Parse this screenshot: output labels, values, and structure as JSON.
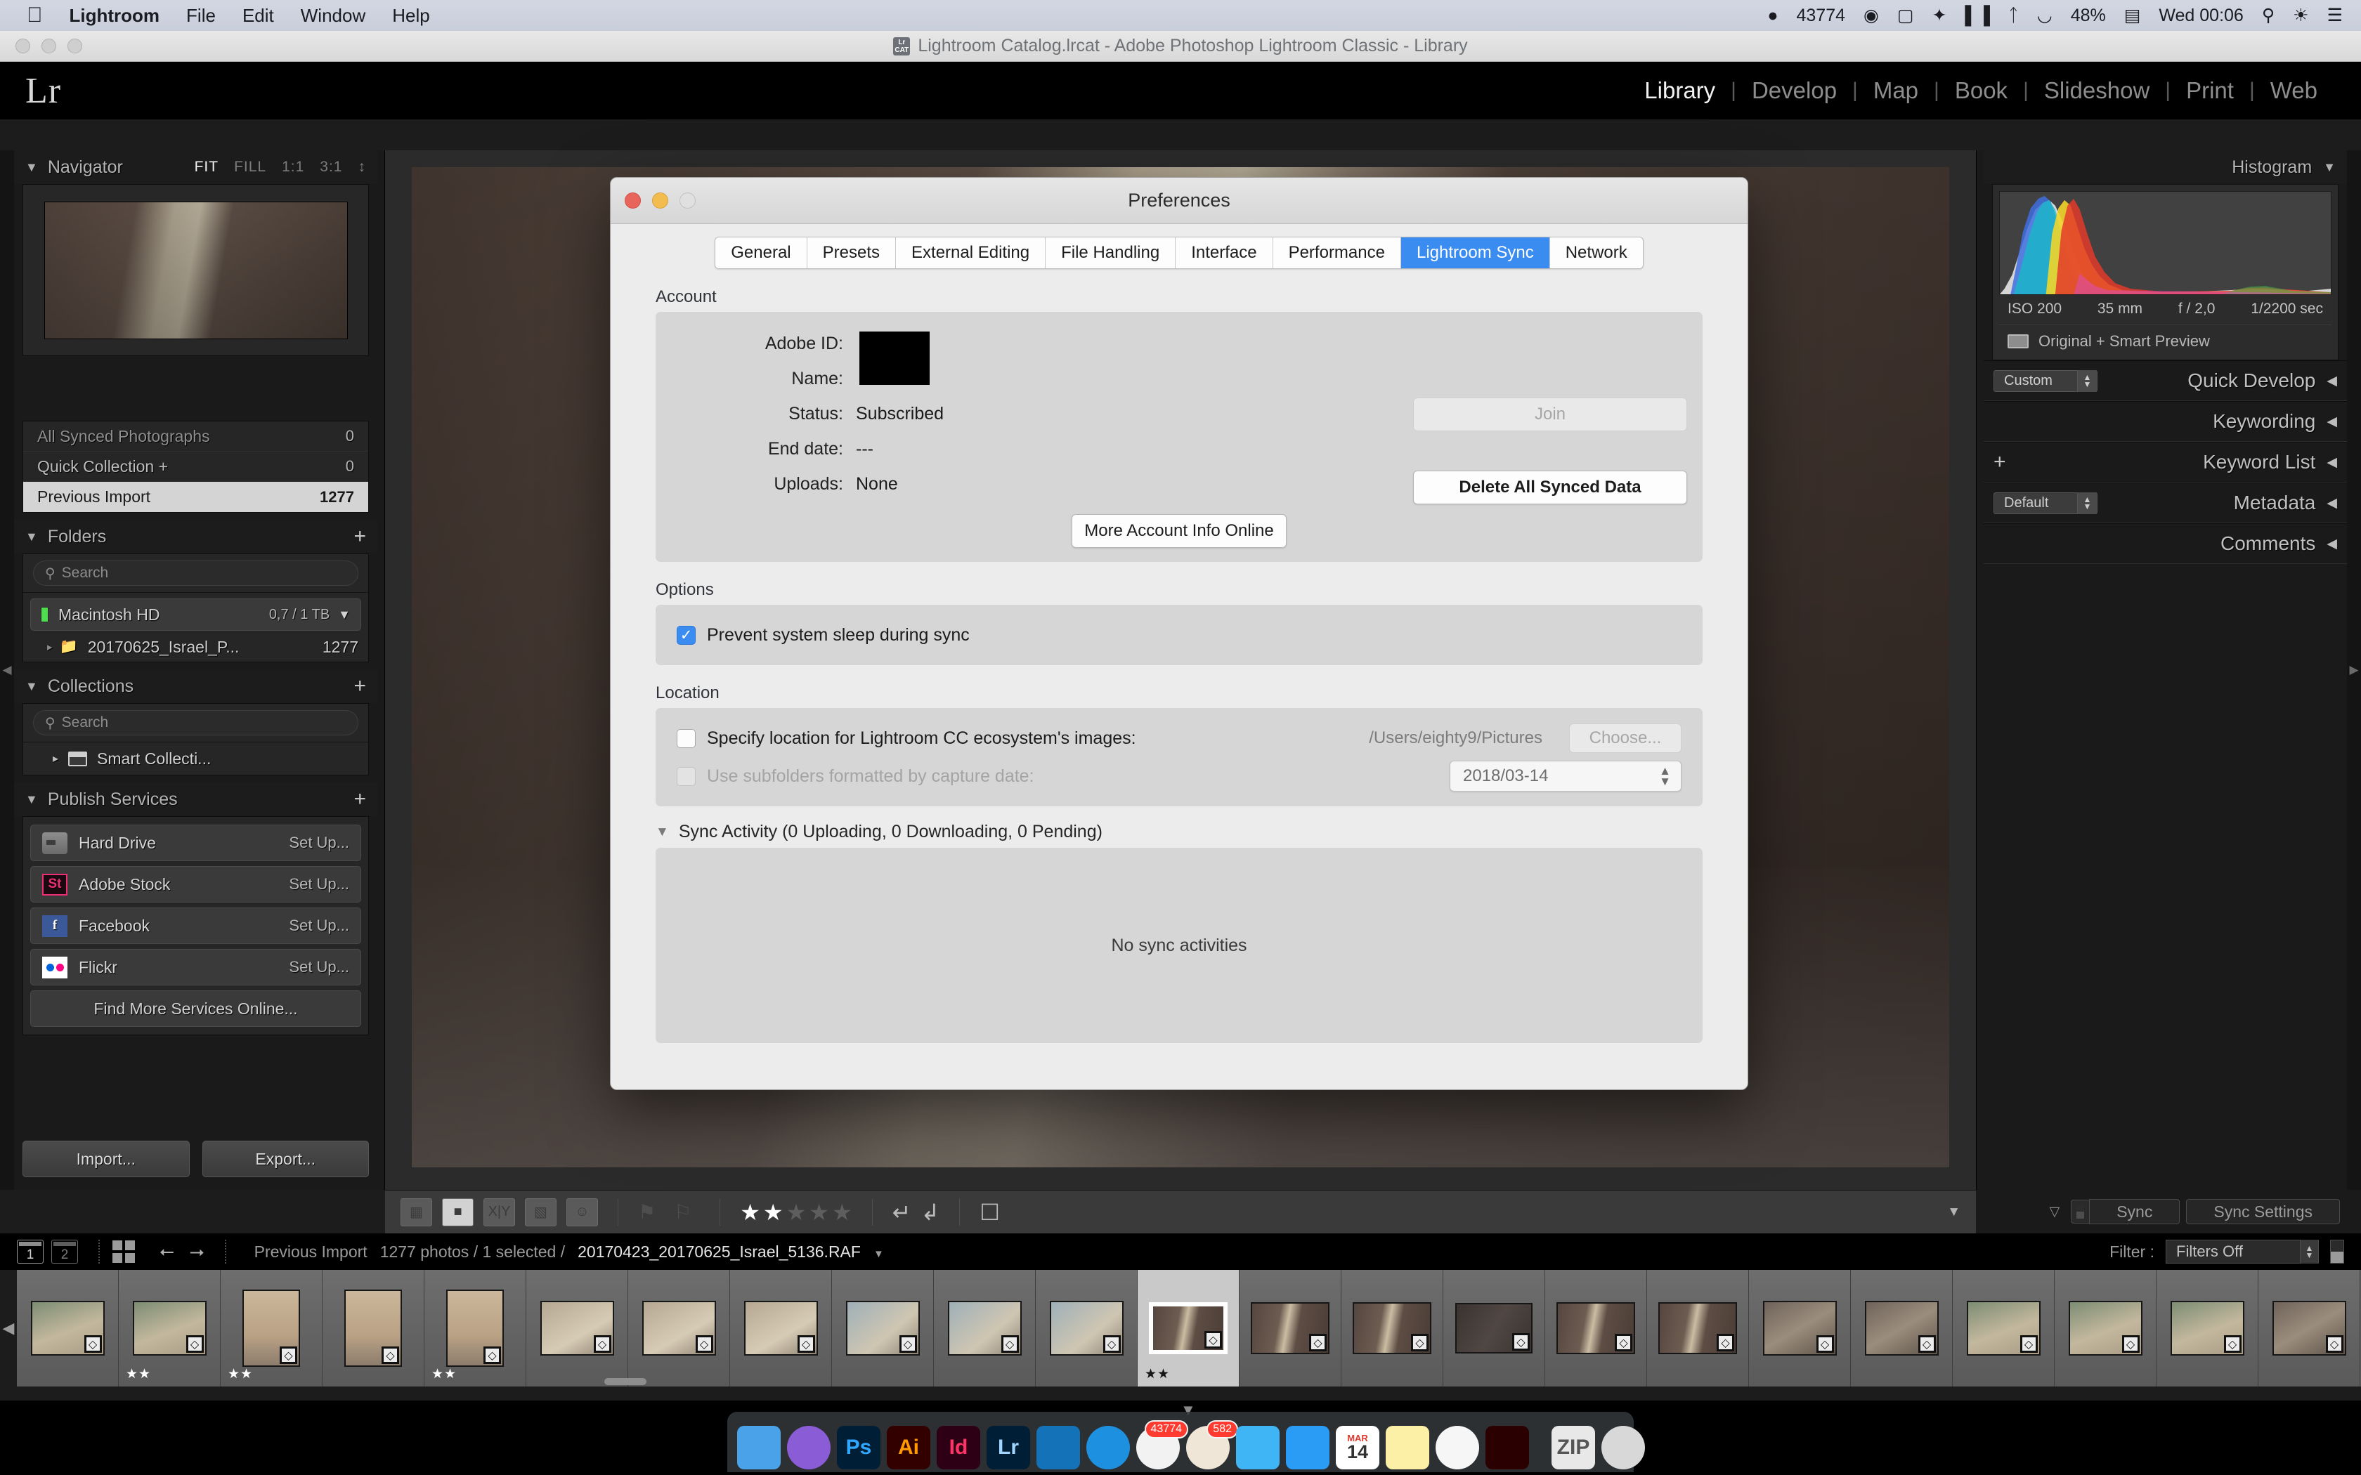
{
  "menubar": {
    "apple": "&#63743;",
    "items": [
      "Lightroom",
      "File",
      "Edit",
      "Window",
      "Help"
    ],
    "status": {
      "adobe_count": "43774",
      "battery": "48%",
      "clock": "Wed 00:06"
    },
    "icon_names": [
      "adobe-cc-icon",
      "creative-cloud-icon",
      "screen-icon",
      "dropbox-icon",
      "equalizer-icon",
      "bluetooth-icon",
      "wifi-icon",
      "battery-icon",
      "spotlight-icon",
      "siri-icon",
      "notification-center-icon"
    ]
  },
  "window": {
    "title": "Lightroom Catalog.lrcat - Adobe Photoshop Lightroom Classic - Library",
    "catalog_badge": "Lr CAT",
    "logo": "Lr"
  },
  "modules": [
    {
      "label": "Library",
      "active": true
    },
    {
      "label": "Develop",
      "active": false
    },
    {
      "label": "Map",
      "active": false
    },
    {
      "label": "Book",
      "active": false
    },
    {
      "label": "Slideshow",
      "active": false
    },
    {
      "label": "Print",
      "active": false
    },
    {
      "label": "Web",
      "active": false
    }
  ],
  "left_panel": {
    "navigator": {
      "title": "Navigator",
      "zoom_options": [
        {
          "label": "FIT",
          "active": true
        },
        {
          "label": "FILL",
          "active": false
        },
        {
          "label": "1:1",
          "active": false
        },
        {
          "label": "3:1",
          "active": false
        }
      ]
    },
    "catalog_rows": [
      {
        "label": "All Synced Photographs",
        "count": "0",
        "selected": false,
        "dim": true
      },
      {
        "label": "Quick Collection +",
        "count": "0",
        "selected": false,
        "dim": false
      },
      {
        "label": "Previous Import",
        "count": "1277",
        "selected": true,
        "dim": false
      }
    ],
    "folders": {
      "title": "Folders",
      "search_placeholder": "Search",
      "drive": {
        "name": "Macintosh HD",
        "capacity": "0,7 / 1 TB"
      },
      "items": [
        {
          "label": "20170625_Israel_P...",
          "count": "1277"
        }
      ]
    },
    "collections": {
      "title": "Collections",
      "search_placeholder": "Search",
      "items": [
        {
          "label": "Smart Collecti..."
        }
      ]
    },
    "publish_services": {
      "title": "Publish Services",
      "items": [
        {
          "name": "Hard Drive",
          "action": "Set Up...",
          "icon": "hard-drive-icon"
        },
        {
          "name": "Adobe Stock",
          "action": "Set Up...",
          "icon": "adobe-stock-icon"
        },
        {
          "name": "Facebook",
          "action": "Set Up...",
          "icon": "facebook-icon"
        },
        {
          "name": "Flickr",
          "action": "Set Up...",
          "icon": "flickr-icon"
        }
      ],
      "find_more": "Find More Services Online..."
    },
    "buttons": {
      "import": "Import...",
      "export": "Export..."
    }
  },
  "right_panel": {
    "histogram": {
      "title": "Histogram",
      "iso": "ISO 200",
      "focal": "35 mm",
      "aperture": "f / 2,0",
      "shutter": "1/2200 sec",
      "preview_status": "Original + Smart Preview"
    },
    "sections": [
      {
        "title": "Quick Develop",
        "select": "Custom"
      },
      {
        "title": "Keywording",
        "select": null
      },
      {
        "title": "Keyword List",
        "select": null
      },
      {
        "title": "Metadata",
        "select": "Default"
      },
      {
        "title": "Comments",
        "select": null
      }
    ]
  },
  "toolbar": {
    "view_icons": [
      "grid-view-icon",
      "loupe-view-icon",
      "compare-view-icon",
      "survey-view-icon",
      "people-view-icon"
    ],
    "flag_icons": [
      "flag-pick-icon",
      "flag-reject-icon"
    ],
    "rating": {
      "filled": 2,
      "total": 5
    },
    "rotate_icons": [
      "rotate-left-icon",
      "rotate-right-icon"
    ],
    "crop_icon": "crop-overlay-icon"
  },
  "sync_bar": {
    "sync": "Sync",
    "sync_settings": "Sync Settings"
  },
  "filmstrip": {
    "screens": [
      "1",
      "2"
    ],
    "source": "Previous Import",
    "counts": "1277 photos / 1 selected /",
    "filename": "20170423_20170625_Israel_5136.RAF",
    "filter_label": "Filter :",
    "filter_value": "Filters Off",
    "thumbs": [
      {
        "stars": 0,
        "badge": true,
        "selected": false,
        "kind": "alley"
      },
      {
        "stars": 2,
        "badge": true,
        "selected": false,
        "kind": "alley"
      },
      {
        "stars": 2,
        "badge": true,
        "selected": false,
        "kind": "wall"
      },
      {
        "stars": 0,
        "badge": true,
        "selected": false,
        "kind": "wall"
      },
      {
        "stars": 2,
        "badge": true,
        "selected": false,
        "kind": "wall"
      },
      {
        "stars": 0,
        "badge": true,
        "selected": false,
        "kind": "street"
      },
      {
        "stars": 0,
        "badge": true,
        "selected": false,
        "kind": "street"
      },
      {
        "stars": 0,
        "badge": true,
        "selected": false,
        "kind": "street"
      },
      {
        "stars": 0,
        "badge": true,
        "selected": false,
        "kind": "sign"
      },
      {
        "stars": 0,
        "badge": true,
        "selected": false,
        "kind": "sign"
      },
      {
        "stars": 0,
        "badge": true,
        "selected": false,
        "kind": "sign"
      },
      {
        "stars": 2,
        "badge": true,
        "selected": true,
        "kind": "arch"
      },
      {
        "stars": 0,
        "badge": true,
        "selected": false,
        "kind": "arch"
      },
      {
        "stars": 0,
        "badge": true,
        "selected": false,
        "kind": "arch"
      },
      {
        "stars": 0,
        "badge": true,
        "selected": false,
        "kind": "dark"
      },
      {
        "stars": 0,
        "badge": true,
        "selected": false,
        "kind": "arch"
      },
      {
        "stars": 0,
        "badge": true,
        "selected": false,
        "kind": "arch"
      },
      {
        "stars": 0,
        "badge": true,
        "selected": false,
        "kind": "stone"
      },
      {
        "stars": 0,
        "badge": true,
        "selected": false,
        "kind": "stone"
      },
      {
        "stars": 0,
        "badge": true,
        "selected": false,
        "kind": "alley"
      },
      {
        "stars": 0,
        "badge": true,
        "selected": false,
        "kind": "alley"
      },
      {
        "stars": 0,
        "badge": true,
        "selected": false,
        "kind": "alley"
      },
      {
        "stars": 0,
        "badge": true,
        "selected": false,
        "kind": "stone"
      }
    ]
  },
  "preferences": {
    "title": "Preferences",
    "tabs": [
      {
        "label": "General",
        "active": false
      },
      {
        "label": "Presets",
        "active": false
      },
      {
        "label": "External Editing",
        "active": false
      },
      {
        "label": "File Handling",
        "active": false
      },
      {
        "label": "Interface",
        "active": false
      },
      {
        "label": "Performance",
        "active": false
      },
      {
        "label": "Lightroom Sync",
        "active": true
      },
      {
        "label": "Network",
        "active": false
      }
    ],
    "account": {
      "group_label": "Account",
      "rows": [
        {
          "label": "Adobe ID:",
          "value": ""
        },
        {
          "label": "Name:",
          "value": ""
        },
        {
          "label": "Status:",
          "value": "Subscribed"
        },
        {
          "label": "End date:",
          "value": "---"
        },
        {
          "label": "Uploads:",
          "value": "None"
        }
      ],
      "join_button": "Join",
      "delete_button": "Delete All Synced Data",
      "more_info_button": "More Account Info Online"
    },
    "options": {
      "group_label": "Options",
      "prevent_sleep": {
        "label": "Prevent system sleep during sync",
        "checked": true
      }
    },
    "location": {
      "group_label": "Location",
      "specify": {
        "label": "Specify location for Lightroom CC ecosystem's images:",
        "checked": false
      },
      "path": "/Users/eighty9/Pictures",
      "choose_button": "Choose...",
      "subfolders": {
        "label": "Use subfolders formatted by capture date:",
        "checked": false
      },
      "date_format": "2018/03-14"
    },
    "sync_activity": {
      "header": "Sync Activity  (0 Uploading, 0 Downloading, 0 Pending)",
      "empty_message": "No sync activities"
    }
  },
  "dock": {
    "items": [
      {
        "name": "finder",
        "label": "",
        "color": "#4aa3e8"
      },
      {
        "name": "siri",
        "label": "",
        "color": "#8a5cd6"
      },
      {
        "name": "photoshop",
        "label": "Ps",
        "color": "#001e36",
        "text": "#31a8ff"
      },
      {
        "name": "illustrator",
        "label": "Ai",
        "color": "#330000",
        "text": "#ff9a00"
      },
      {
        "name": "indesign",
        "label": "Id",
        "color": "#2d0016",
        "text": "#ff3366"
      },
      {
        "name": "lightroom",
        "label": "Lr",
        "color": "#001e36",
        "text": "#9fd5ff"
      },
      {
        "name": "bridge",
        "label": "",
        "color": "#1473b8"
      },
      {
        "name": "safari",
        "label": "",
        "color": "#1e90e0"
      },
      {
        "name": "adobe-cc",
        "label": "",
        "color": "#f2f2f2",
        "badge": "43774"
      },
      {
        "name": "rss-reader",
        "label": "",
        "color": "#f0e6d8",
        "badge": "582"
      },
      {
        "name": "messages",
        "label": "",
        "color": "#3fb5f5"
      },
      {
        "name": "messenger",
        "label": "",
        "color": "#2b9cf5"
      },
      {
        "name": "calendar",
        "label": "14",
        "color": "#ffffff",
        "text": "#333333",
        "sub": "MAR"
      },
      {
        "name": "notes",
        "label": "",
        "color": "#fbf0a6"
      },
      {
        "name": "photos",
        "label": "",
        "color": "#f6f6f6"
      },
      {
        "name": "acrobat",
        "label": "",
        "color": "#2b0000",
        "text": "#ffffff"
      },
      {
        "name": "zip-archive",
        "label": "ZIP",
        "color": "#e8e8e8",
        "text": "#555555"
      },
      {
        "name": "trash",
        "label": "",
        "color": "#d8d8d8"
      }
    ]
  }
}
